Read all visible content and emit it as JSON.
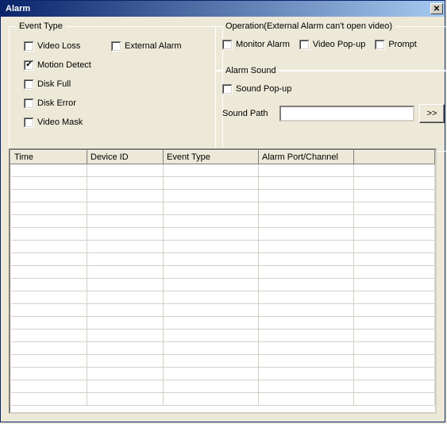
{
  "window": {
    "title": "Alarm"
  },
  "eventType": {
    "legend": "Event Type",
    "items": [
      {
        "label": "Video Loss",
        "checked": false
      },
      {
        "label": "Motion Detect",
        "checked": true
      },
      {
        "label": "Disk Full",
        "checked": false
      },
      {
        "label": "Disk Error",
        "checked": false
      },
      {
        "label": "Video Mask",
        "checked": false
      }
    ],
    "externalAlarm": {
      "label": "External Alarm",
      "checked": false
    }
  },
  "operation": {
    "legend": "Operation(External Alarm can't open video)",
    "monitorAlarm": {
      "label": "Monitor Alarm",
      "checked": false
    },
    "videoPopup": {
      "label": "Video Pop-up",
      "checked": false
    },
    "prompt": {
      "label": "Prompt",
      "checked": false
    }
  },
  "alarmSound": {
    "legend": "Alarm Sound",
    "soundPopup": {
      "label": "Sound Pop-up",
      "checked": false
    },
    "soundPathLabel": "Sound Path",
    "soundPathValue": "",
    "browseLabel": ">>"
  },
  "table": {
    "columns": [
      "Time",
      "Device ID",
      "Event Type",
      "Alarm Port/Channel",
      ""
    ],
    "rows": []
  }
}
